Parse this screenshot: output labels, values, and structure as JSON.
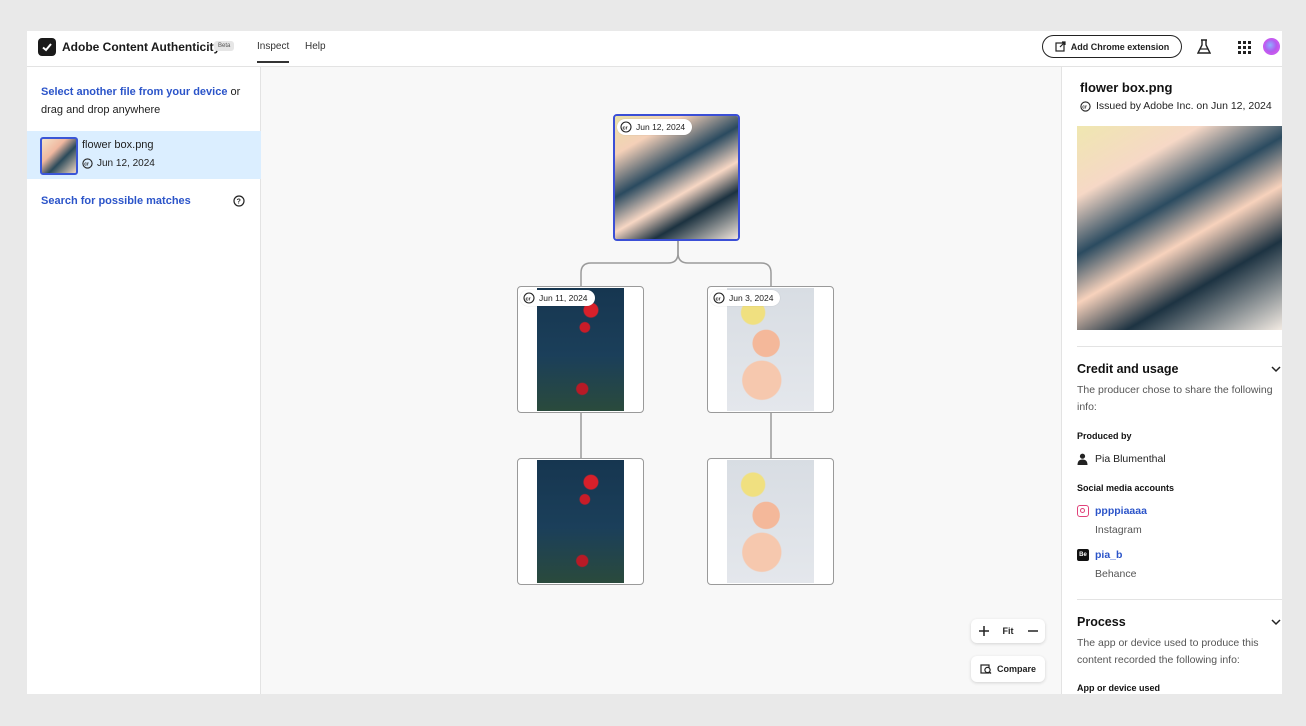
{
  "header": {
    "app_title": "Adobe Content Authenticity",
    "beta_label": "Beta",
    "tabs": [
      {
        "label": "Inspect",
        "active": true
      },
      {
        "label": "Help",
        "active": false
      }
    ],
    "extension_button": "Add Chrome extension",
    "icons": [
      "flask-icon",
      "apps-grid-icon",
      "avatar"
    ]
  },
  "sidebar": {
    "select_link": "Select another file from your device",
    "select_suffix": " or drag and drop anywhere",
    "file": {
      "name": "flower box.png",
      "date": "Jun 12, 2024"
    },
    "search_link": "Search for possible matches"
  },
  "canvas": {
    "nodes": [
      {
        "date": "Jun 12, 2024",
        "image": "flower-box-collage"
      },
      {
        "date": "Jun 11, 2024",
        "image": "red-flowers-dark"
      },
      {
        "date": "Jun 3, 2024",
        "image": "peach-flowers-light"
      },
      {
        "date": "",
        "image": "red-flowers-dark"
      },
      {
        "date": "",
        "image": "peach-flowers-light"
      }
    ],
    "zoom_fit_label": "Fit",
    "compare_label": "Compare"
  },
  "details": {
    "file_name": "flower box.png",
    "issued": "Issued by Adobe Inc. on Jun 12, 2024",
    "credit": {
      "title": "Credit and usage",
      "description": "The producer chose to share the following info:",
      "produced_by_label": "Produced by",
      "producer": "Pia Blumenthal",
      "social_label": "Social media accounts",
      "accounts": [
        {
          "handle": "ppppiaaaa",
          "platform": "Instagram"
        },
        {
          "handle": "pia_b",
          "platform": "Behance"
        }
      ]
    },
    "process": {
      "title": "Process",
      "description": "The app or device used to produce this content recorded the following info:",
      "app_label": "App or device used"
    }
  },
  "colors": {
    "accent": "#2b54c9",
    "selected_border": "#3b4fd6",
    "file_highlight": "#dbeeff"
  }
}
